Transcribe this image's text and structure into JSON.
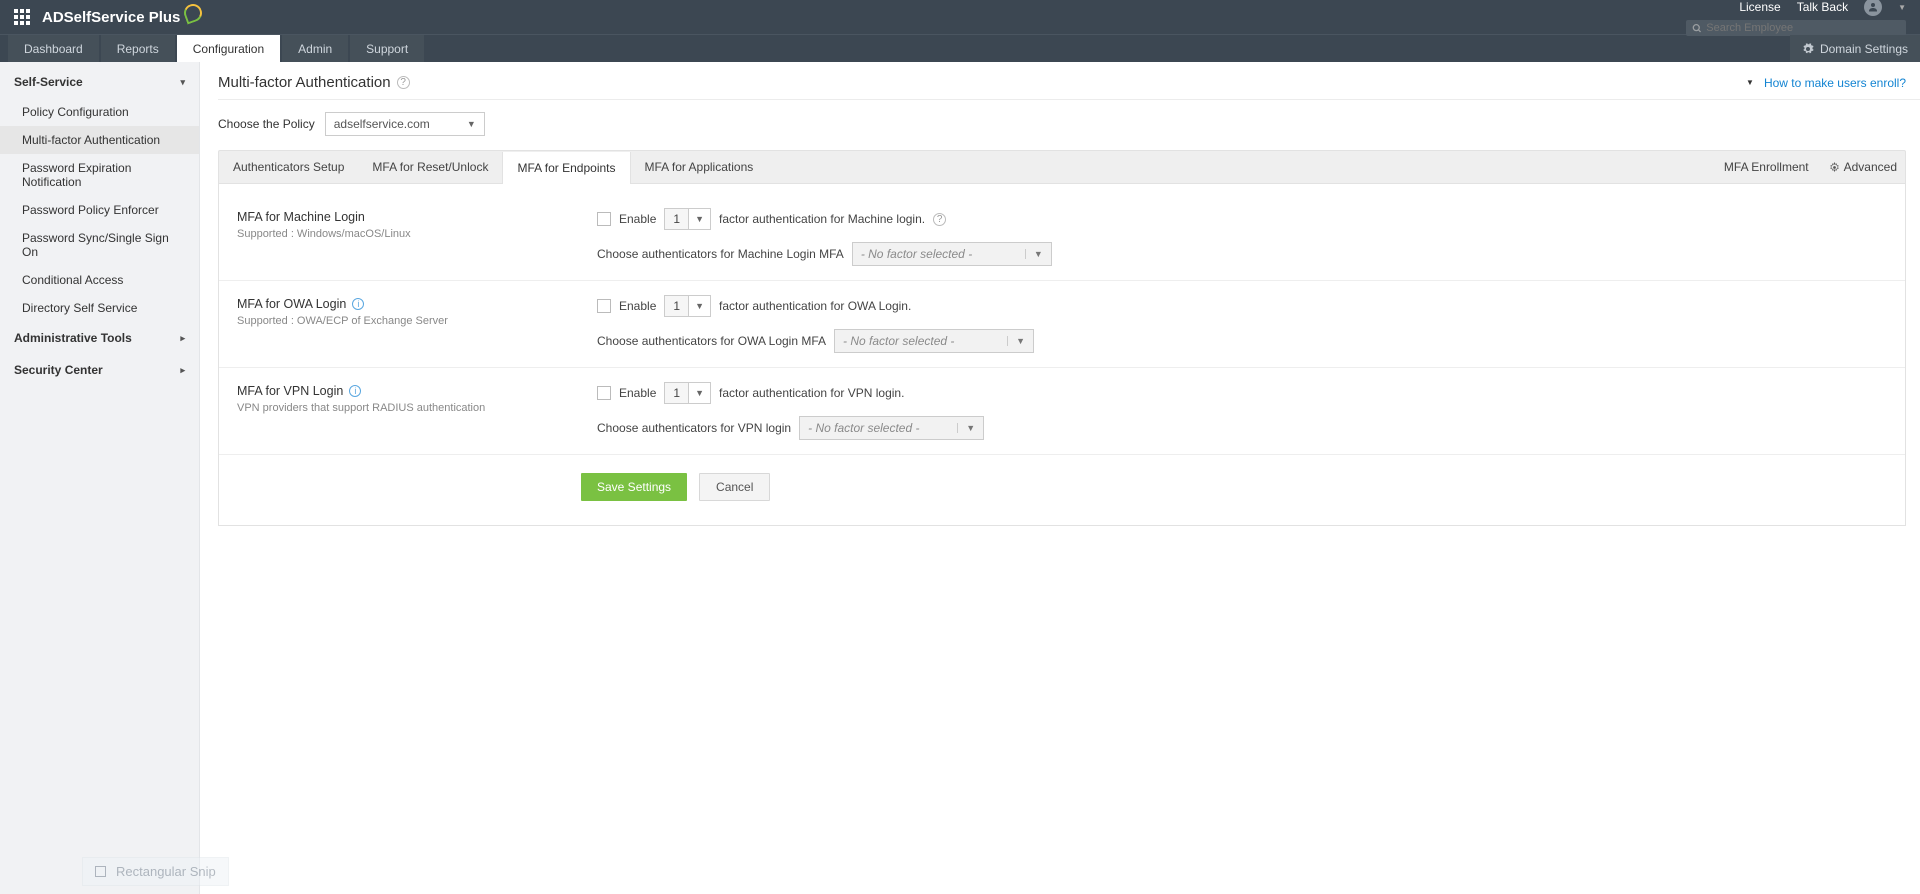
{
  "header": {
    "brand": "ADSelfService Plus",
    "license": "License",
    "talkback": "Talk Back",
    "search_placeholder": "Search Employee"
  },
  "nav": {
    "dashboard": "Dashboard",
    "reports": "Reports",
    "configuration": "Configuration",
    "admin": "Admin",
    "support": "Support",
    "domain_settings": "Domain Settings"
  },
  "sidebar": {
    "self_service": "Self-Service",
    "items": [
      "Policy Configuration",
      "Multi-factor Authentication",
      "Password Expiration Notification",
      "Password Policy Enforcer",
      "Password Sync/Single Sign On",
      "Conditional Access",
      "Directory Self Service"
    ],
    "admin_tools": "Administrative Tools",
    "security_center": "Security Center"
  },
  "page": {
    "title": "Multi-factor Authentication",
    "enroll_link": "How to make users enroll?",
    "choose_policy_label": "Choose the Policy",
    "policy_value": "adselfservice.com"
  },
  "tabs": {
    "auth_setup": "Authenticators Setup",
    "reset_unlock": "MFA for Reset/Unlock",
    "endpoints": "MFA for Endpoints",
    "applications": "MFA for Applications",
    "enrollment": "MFA Enrollment",
    "advanced": "Advanced"
  },
  "mfa": {
    "enable": "Enable",
    "factor_value": "1",
    "no_factor": "- No factor selected -",
    "machine": {
      "title": "MFA for Machine Login",
      "sub": "Supported : Windows/macOS/Linux",
      "suffix": "factor authentication for Machine login.",
      "choose": "Choose authenticators for Machine Login MFA"
    },
    "owa": {
      "title": "MFA for OWA Login",
      "sub": "Supported : OWA/ECP of Exchange Server",
      "suffix": "factor authentication for OWA Login.",
      "choose": "Choose authenticators for OWA Login MFA"
    },
    "vpn": {
      "title": "MFA for VPN Login",
      "sub": "VPN providers that support RADIUS authentication",
      "suffix": "factor authentication for VPN login.",
      "choose": "Choose authenticators for VPN login"
    }
  },
  "buttons": {
    "save": "Save Settings",
    "cancel": "Cancel"
  },
  "snip": "Rectangular Snip"
}
